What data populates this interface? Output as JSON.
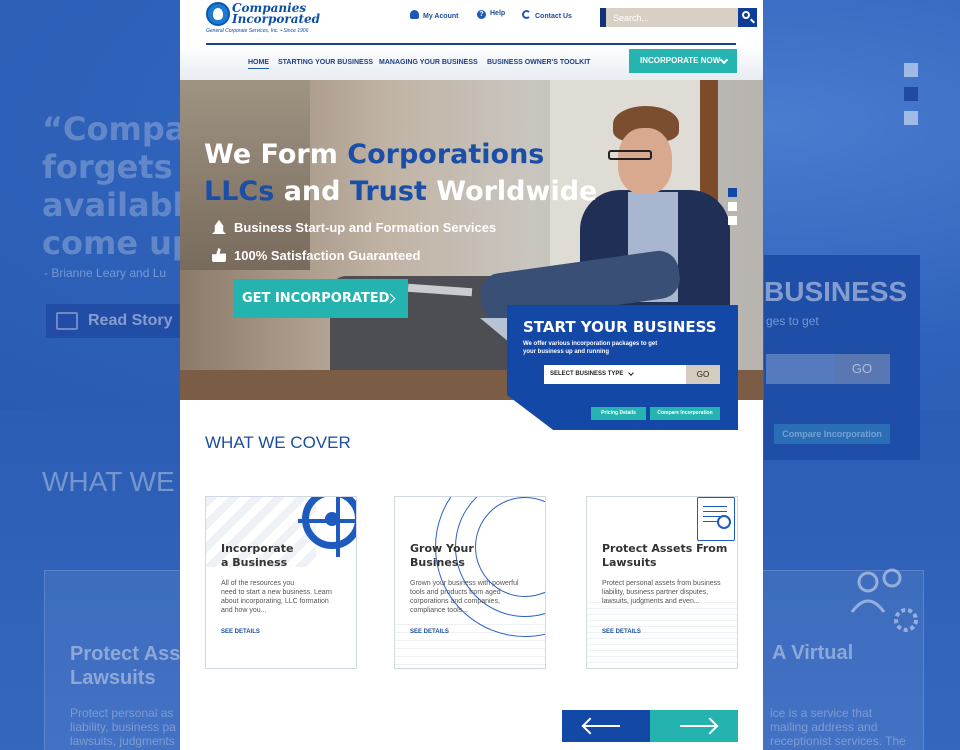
{
  "background": {
    "quote_lines": "“Compani\nforgets a\navailable\ncome up",
    "quote_author": "- Brianne Leary and Lu",
    "read_story": "Read Story",
    "what_we": "WHAT WE C",
    "protect": "Protect Ass\nLawsuits",
    "protect_text": "Protect personal as\nliability, business pa\nlawsuits, judgments",
    "virtual": "A Virtual",
    "virtual_text": "ice is a service that\nmailing address and\nreceptionist services. The",
    "start_title": "BUSINESS",
    "start_sub": "ges to get",
    "go": "GO",
    "compare": "Compare Incorporation"
  },
  "logo": {
    "name": "Companies\nIncorporated",
    "tagline": "General Corporate Services, Inc. • Since 1906"
  },
  "toplinks": {
    "account": "My Acount",
    "help": "Help",
    "contact": "Contact Us"
  },
  "search": {
    "placeholder": "Search..."
  },
  "nav": {
    "items": [
      {
        "label": "HOME"
      },
      {
        "label": "STARTING YOUR BUSINESS"
      },
      {
        "label": "MANAGING YOUR BUSINESS"
      },
      {
        "label": "BUSINESS OWNER'S TOOLKIT"
      }
    ],
    "cta": "INCORPORATE NOW"
  },
  "hero": {
    "line1_a": "We Form ",
    "line1_b": "Corporations",
    "line2_a": "LLCs",
    "line2_b": " and ",
    "line2_c": "Trust",
    "line2_d": " Worldwide",
    "feature1": "Business Start-up and Formation Services",
    "feature2": "100% Satisfaction Guaranteed",
    "cta": "GET INCORPORATED"
  },
  "start_box": {
    "title": "START YOUR BUSINESS",
    "subtitle": "We offer various incorporation packages to get\nyour business up and running",
    "select": "SELECT BUSINESS TYPE",
    "go": "GO",
    "pricing": "Pricing Details",
    "compare": "Compare Incorporation"
  },
  "cover": {
    "title": "WHAT WE COVER",
    "cards": [
      {
        "title": "Incorporate\na Business",
        "body": "All of the resources you\nneed to start a new business. Learn\nabout incorporating, LLC formation\nand how you...",
        "link": "SEE DETAILS"
      },
      {
        "title": "Grow Your\nBusiness",
        "body": "Grown your business with powerful\ntools and products from aged\ncorporations and companies,\ncompliance tools...",
        "link": "SEE DETAILS"
      },
      {
        "title": "Protect Assets From\nLawsuits",
        "body": "Protect personal assets from business\nliability, business partner disputes,\nlawsuits, judgments and even...",
        "link": "SEE DETAILS"
      }
    ]
  },
  "colors": {
    "brand_blue": "#1448a6",
    "teal": "#25b3b0",
    "nav_text": "#1d3f86"
  }
}
